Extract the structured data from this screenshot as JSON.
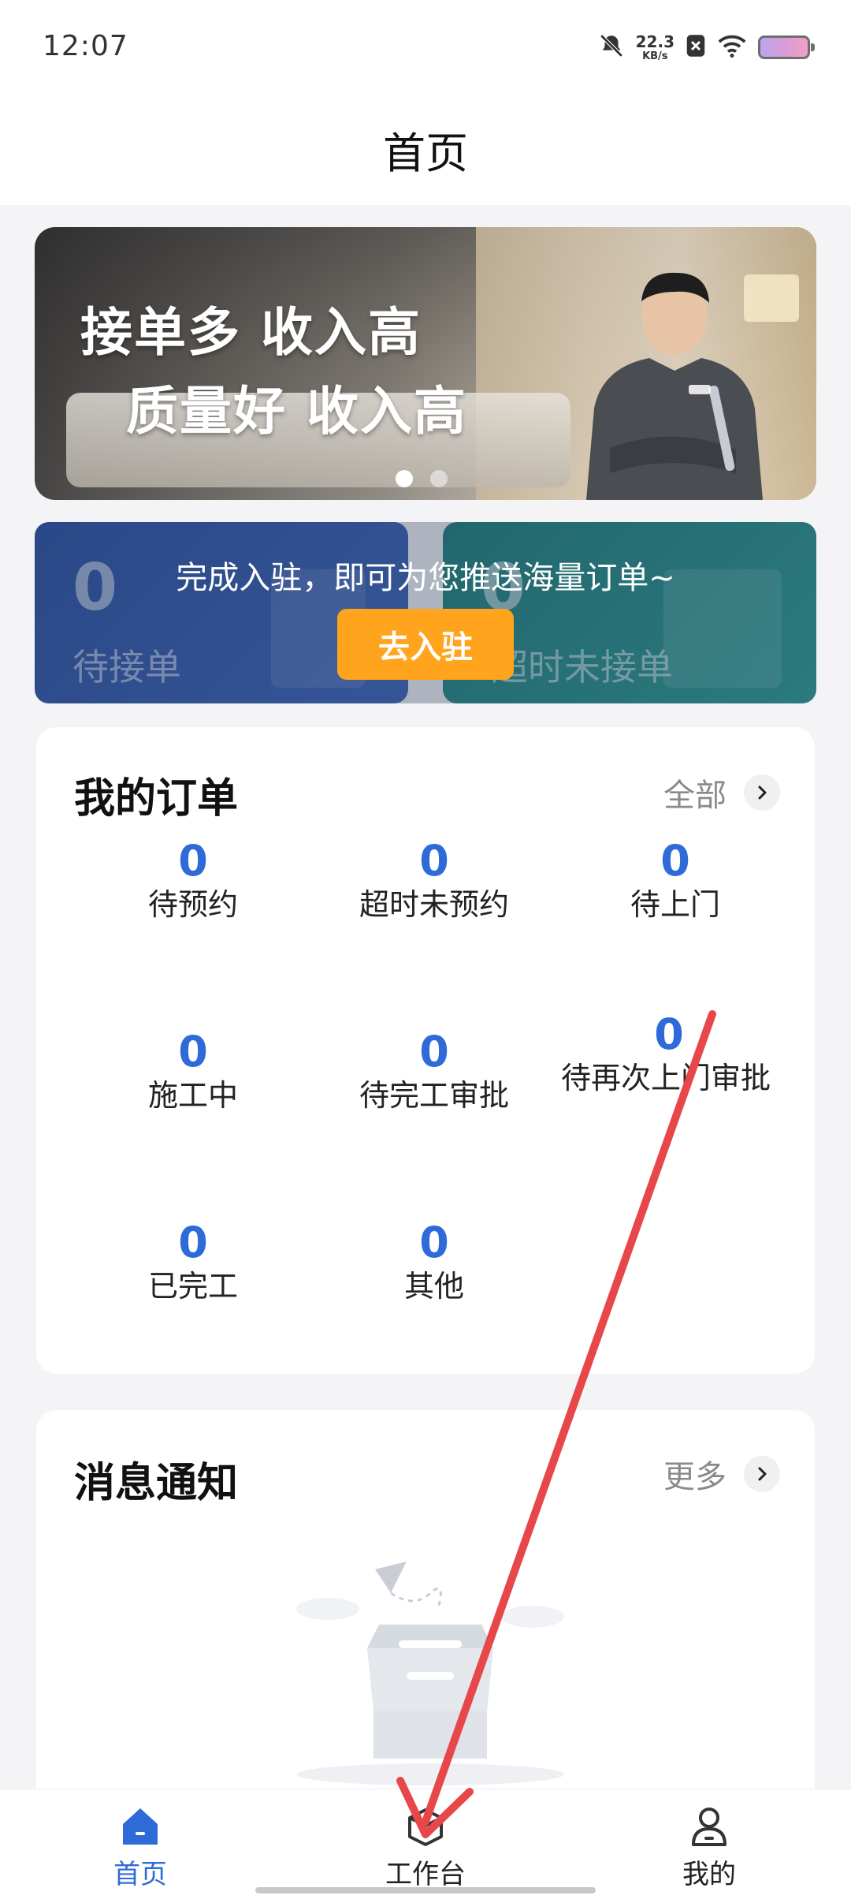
{
  "status_bar": {
    "time": "12:07",
    "net_speed_value": "22.3",
    "net_speed_unit": "KB/s",
    "icons": [
      "mute-bell-icon",
      "sim-off-icon",
      "wifi-icon",
      "battery-icon"
    ]
  },
  "header": {
    "title": "首页"
  },
  "banner": {
    "line1": "接单多 收入高",
    "line2": "质量好 收入高",
    "slide_count": 2,
    "active_slide": 1
  },
  "stats": {
    "cards": [
      {
        "count": "0",
        "label": "待接单"
      },
      {
        "count": "0",
        "label": "超时未接单"
      }
    ],
    "notice": "完成入驻，即可为您推送海量订单~",
    "join_button": "去入驻"
  },
  "orders": {
    "title": "我的订单",
    "more_label": "全部",
    "items": [
      {
        "count": "0",
        "label": "待预约"
      },
      {
        "count": "0",
        "label": "超时未预约"
      },
      {
        "count": "0",
        "label": "待上门"
      },
      {
        "count": "0",
        "label": "施工中"
      },
      {
        "count": "0",
        "label": "待完工审批"
      },
      {
        "count": "0",
        "label": "待再次上门审批"
      },
      {
        "count": "0",
        "label": "已完工"
      },
      {
        "count": "0",
        "label": "其他"
      }
    ]
  },
  "notifications": {
    "title": "消息通知",
    "more_label": "更多"
  },
  "tab_bar": {
    "items": [
      {
        "label": "首页",
        "icon": "home-icon",
        "active": true
      },
      {
        "label": "工作台",
        "icon": "workbench-box-icon",
        "active": false
      },
      {
        "label": "我的",
        "icon": "profile-icon",
        "active": false
      }
    ]
  },
  "colors": {
    "accent": "#2f6bd8",
    "join_button": "#ffa41c",
    "annotation_arrow": "#e8474a"
  }
}
